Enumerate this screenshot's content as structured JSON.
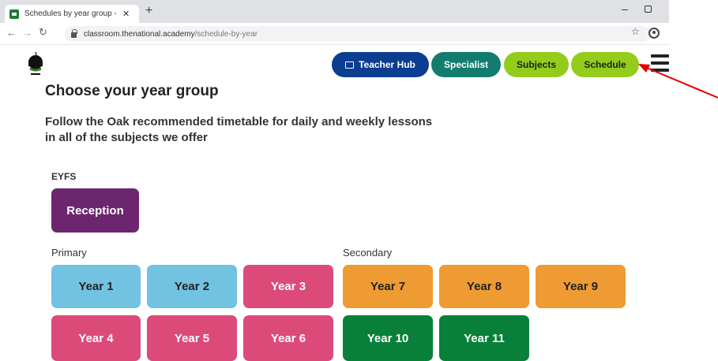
{
  "browser": {
    "tab_title": "Schedules by year group - Oak N",
    "tab_close": "✕",
    "new_tab": "+",
    "url_host": "classroom.thenational.academy",
    "url_path": "/schedule-by-year",
    "minimize": "–"
  },
  "nav": {
    "teacher_hub": "Teacher Hub",
    "specialist": "Specialist",
    "subjects": "Subjects",
    "schedule": "Schedule"
  },
  "page": {
    "title": "Choose your year group",
    "lead": "Follow the Oak recommended timetable for daily and weekly lessons in all of the subjects we offer"
  },
  "groups": {
    "eyfs_label": "EYFS",
    "primary_label": "Primary",
    "secondary_label": "Secondary"
  },
  "years": {
    "reception": "Reception",
    "y1": "Year 1",
    "y2": "Year 2",
    "y3": "Year 3",
    "y4": "Year 4",
    "y5": "Year 5",
    "y6": "Year 6",
    "y7": "Year 7",
    "y8": "Year 8",
    "y9": "Year 9",
    "y10": "Year 10",
    "y11": "Year 11"
  },
  "colors": {
    "teacher_hub": "#0b3d91",
    "specialist": "#127d6f",
    "lime": "#94cc1c",
    "reception": "#6c2670",
    "blue": "#72c2e2",
    "pink": "#dc4a7a",
    "orange": "#ee9b33",
    "green": "#08803a",
    "annotation_arrow": "#e00000"
  }
}
